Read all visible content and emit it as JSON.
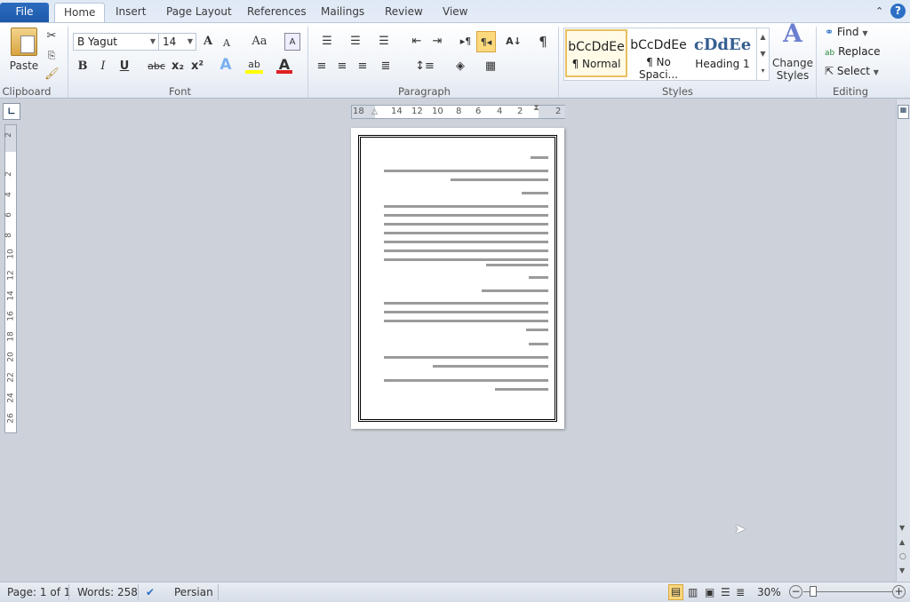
{
  "tabs": [
    "File",
    "Home",
    "Insert",
    "Page Layout",
    "References",
    "Mailings",
    "Review",
    "View"
  ],
  "clipboard": {
    "paste": "Paste",
    "label": "Clipboard"
  },
  "font": {
    "name": "B Yagut",
    "size": "14",
    "label": "Font",
    "bold": "B",
    "italic": "I",
    "underline": "U",
    "strike": "abc",
    "sub": "x₂",
    "sup": "x²",
    "grow": "A",
    "shrink": "A",
    "case": "Aa",
    "effects": "A",
    "highlight": "ab",
    "color": "A",
    "highlight_color": "#ffff00",
    "font_color": "#e02020"
  },
  "paragraph": {
    "label": "Paragraph",
    "pilcrow": "¶"
  },
  "styles": {
    "label": "Styles",
    "items": [
      {
        "sample": "bCcDdEe",
        "name": "¶ Normal"
      },
      {
        "sample": "bCcDdEe",
        "name": "¶ No Spaci..."
      },
      {
        "sample": "cDdEe",
        "name": "Heading 1"
      }
    ],
    "change": "Change",
    "change2": "Styles"
  },
  "editing": {
    "label": "Editing",
    "find": "Find",
    "replace": "Replace",
    "select": "Select"
  },
  "ruler": {
    "h": [
      "18",
      "14",
      "12",
      "10",
      "8",
      "6",
      "4",
      "2",
      "2"
    ],
    "v": [
      "2",
      "2",
      "4",
      "6",
      "8",
      "10",
      "12",
      "14",
      "16",
      "18",
      "20",
      "22",
      "24",
      "26"
    ]
  },
  "status": {
    "page": "Page: 1 of 1",
    "words": "Words: 258",
    "language": "Persian",
    "zoom": "30%",
    "zoom_level": 30
  }
}
